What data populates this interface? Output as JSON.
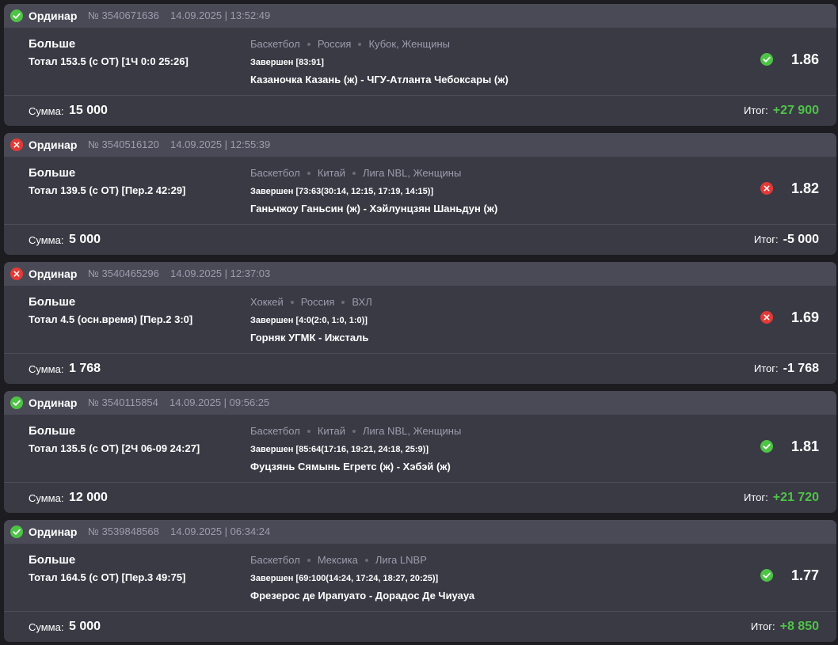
{
  "colors": {
    "background": "#1c1c21",
    "card": "#3a3a45",
    "card_header": "#4a4a57",
    "muted_text": "#9c9cac",
    "win_green": "#4ec346",
    "loss_red": "#e53935"
  },
  "labels": {
    "sum": "Сумма:",
    "total": "Итог:"
  },
  "bets": [
    {
      "status": "win",
      "status_icon": "check-circle-icon",
      "type": "Ординар",
      "id": "№ 3540671636",
      "date": "14.09.2025 | 13:52:49",
      "outcome": "Больше",
      "market": "Тотал 153.5 (с ОТ) [1Ч 0:0 25:26]",
      "sport": "Баскетбол",
      "country": "Россия",
      "league": "Кубок, Женщины",
      "result": "Завершен [83:91]",
      "match": "Казаночка Казань (ж) - ЧГУ-Атланта Чебоксары (ж)",
      "odds": "1.86",
      "sum": "15 000",
      "total": "+27 900"
    },
    {
      "status": "loss",
      "status_icon": "cross-circle-icon",
      "type": "Ординар",
      "id": "№ 3540516120",
      "date": "14.09.2025 | 12:55:39",
      "outcome": "Больше",
      "market": "Тотал 139.5 (с ОТ) [Пер.2 42:29]",
      "sport": "Баскетбол",
      "country": "Китай",
      "league": "Лига NBL, Женщины",
      "result": "Завершен [73:63(30:14, 12:15, 17:19, 14:15)]",
      "match": "Ганьчжоу Ганьсин (ж) - Хэйлунцзян Шаньдун (ж)",
      "odds": "1.82",
      "sum": "5 000",
      "total": "-5 000"
    },
    {
      "status": "loss",
      "status_icon": "cross-circle-icon",
      "type": "Ординар",
      "id": "№ 3540465296",
      "date": "14.09.2025 | 12:37:03",
      "outcome": "Больше",
      "market": "Тотал 4.5 (осн.время) [Пер.2 3:0]",
      "sport": "Хоккей",
      "country": "Россия",
      "league": "ВХЛ",
      "result": "Завершен [4:0(2:0, 1:0, 1:0)]",
      "match": "Горняк УГМК - Ижсталь",
      "odds": "1.69",
      "sum": "1 768",
      "total": "-1 768"
    },
    {
      "status": "win",
      "status_icon": "check-circle-icon",
      "type": "Ординар",
      "id": "№ 3540115854",
      "date": "14.09.2025 | 09:56:25",
      "outcome": "Больше",
      "market": "Тотал 135.5 (с ОТ) [2Ч 06-09 24:27]",
      "sport": "Баскетбол",
      "country": "Китай",
      "league": "Лига NBL, Женщины",
      "result": "Завершен [85:64(17:16, 19:21, 24:18, 25:9)]",
      "match": "Фуцзянь Сямынь Егретс (ж) - Хэбэй (ж)",
      "odds": "1.81",
      "sum": "12 000",
      "total": "+21 720"
    },
    {
      "status": "win",
      "status_icon": "check-circle-icon",
      "type": "Ординар",
      "id": "№ 3539848568",
      "date": "14.09.2025 | 06:34:24",
      "outcome": "Больше",
      "market": "Тотал 164.5 (с ОТ) [Пер.3 49:75]",
      "sport": "Баскетбол",
      "country": "Мексика",
      "league": "Лига LNBP",
      "result": "Завершен [69:100(14:24, 17:24, 18:27, 20:25)]",
      "match": "Фрезерос де Ирапуато - Дорадос Де Чиуауа",
      "odds": "1.77",
      "sum": "5 000",
      "total": "+8 850"
    }
  ]
}
